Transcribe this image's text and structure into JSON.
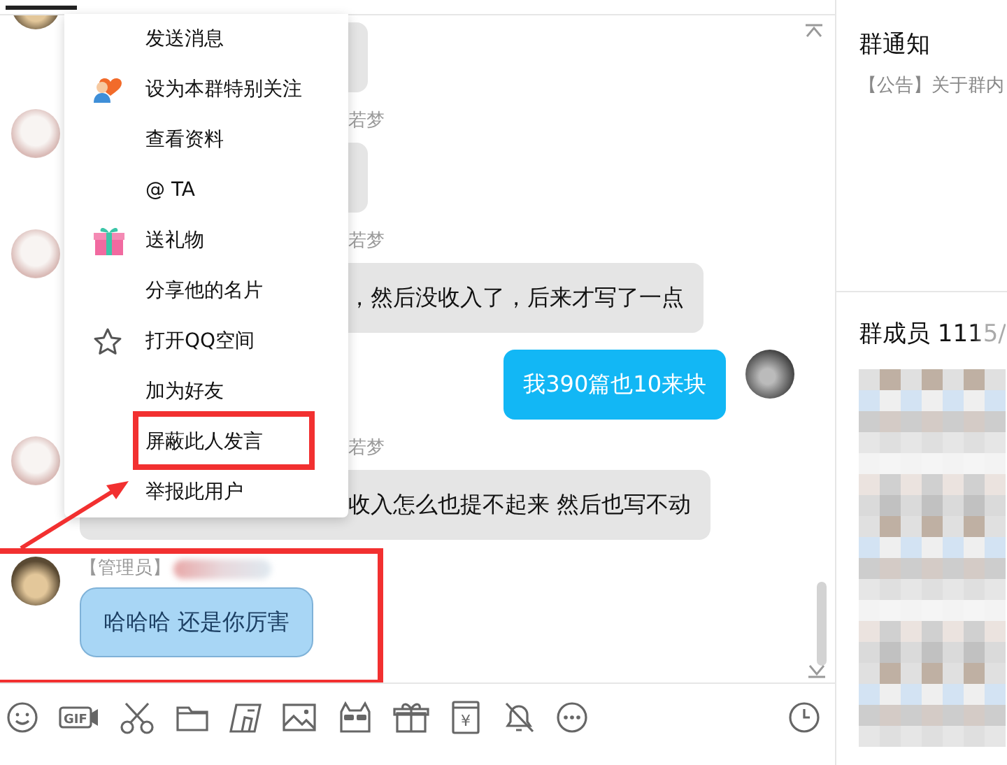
{
  "chat": {
    "messages": [
      {
        "kind": "received",
        "highlighted": false
      },
      {
        "kind": "received",
        "sender": "若梦",
        "highlighted": false
      },
      {
        "kind": "received",
        "sender": "若梦",
        "text": "，然后没收入了，后来才写了一点",
        "highlighted": false
      },
      {
        "kind": "sent",
        "text": "我390篇也10来块",
        "highlighted": false
      },
      {
        "kind": "received",
        "sender": "若梦",
        "text": "收入怎么也提不起来 然后也写不动",
        "highlighted": false
      },
      {
        "kind": "admin",
        "sender": "【管理员】",
        "text": "哈哈哈  还是你厉害",
        "highlighted": true
      }
    ]
  },
  "context_menu": {
    "items": [
      {
        "label": "发送消息",
        "kind": "plain",
        "highlighted": false
      },
      {
        "label": "设为本群特别关注",
        "kind": "follow",
        "highlighted": false
      },
      {
        "label": "查看资料",
        "kind": "plain",
        "highlighted": false
      },
      {
        "label": "@ TA",
        "kind": "plain",
        "highlighted": false
      },
      {
        "label": "送礼物",
        "kind": "gift",
        "highlighted": false
      },
      {
        "label": "分享他的名片",
        "kind": "plain",
        "highlighted": false
      },
      {
        "label": "打开QQ空间",
        "kind": "space",
        "highlighted": false
      },
      {
        "label": "加为好友",
        "kind": "plain",
        "highlighted": false
      },
      {
        "label": "屏蔽此人发言",
        "kind": "plain",
        "highlighted": true
      },
      {
        "label": "举报此用户",
        "kind": "plain",
        "highlighted": false
      }
    ]
  },
  "toolbar": {
    "gif_label": "GIF",
    "wallet_symbol": "¥"
  },
  "side_panel": {
    "notice_title": "群通知",
    "notice_text": "【公告】关于群内",
    "members_title": "群成员 1115/"
  }
}
